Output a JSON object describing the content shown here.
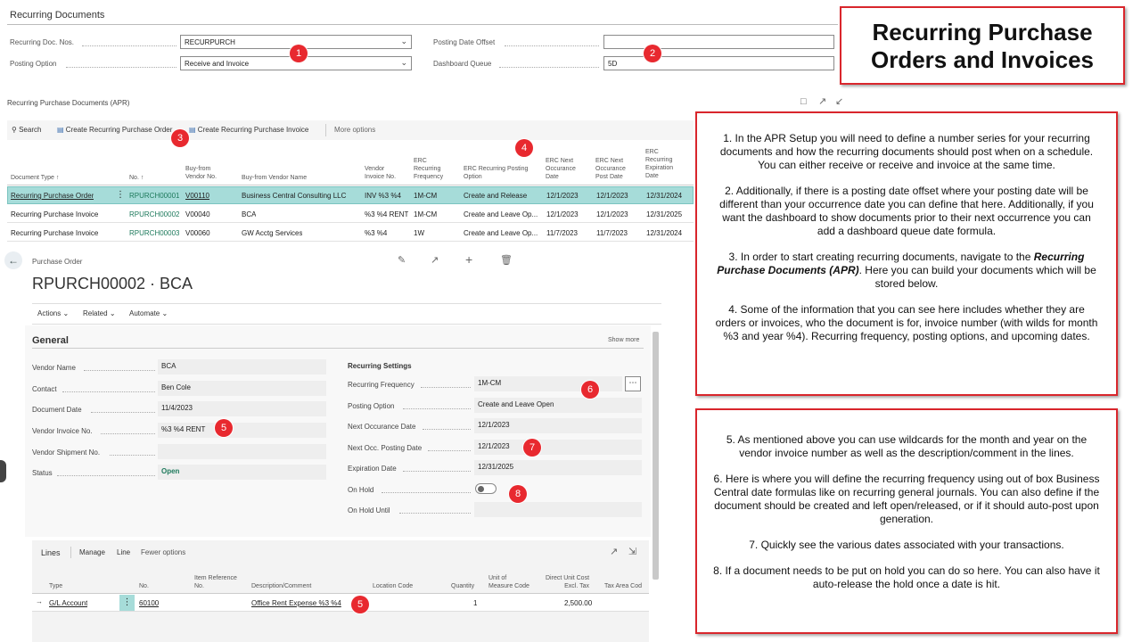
{
  "setup": {
    "title": "Recurring Documents",
    "doc_nos_label": "Recurring Doc. Nos.",
    "doc_nos_value": "RECURPURCH",
    "posting_option_label": "Posting Option",
    "posting_option_value": "Receive and Invoice",
    "posting_date_offset_label": "Posting Date Offset",
    "posting_date_offset_value": "",
    "dashboard_queue_label": "Dashboard Queue",
    "dashboard_queue_value": "5D"
  },
  "list": {
    "title": "Recurring Purchase Documents (APR)",
    "toolbar": {
      "search": "Search",
      "create_order": "Create Recurring Purchase Order",
      "create_invoice": "Create Recurring Purchase Invoice",
      "more": "More options"
    },
    "columns": {
      "doc_type": "Document Type ↑",
      "no": "No. ↑",
      "vendor_no_1": "Buy-from",
      "vendor_no_2": "Vendor No.",
      "vendor_name": "Buy-from Vendor Name",
      "invoice_no_1": "Vendor",
      "invoice_no_2": "Invoice No.",
      "freq_1": "ERC",
      "freq_2": "Recurring",
      "freq_3": "Frequency",
      "posting_1": "ERC Recurring Posting",
      "posting_2": "Option",
      "next_occ_1": "ERC Next",
      "next_occ_2": "Occurance",
      "next_occ_3": "Date",
      "next_post_1": "ERC Next",
      "next_post_2": "Occurance",
      "next_post_3": "Post Date",
      "exp_1": "ERC",
      "exp_2": "Recurring",
      "exp_3": "Expiration",
      "exp_4": "Date"
    },
    "rows": [
      {
        "type": "Recurring Purchase Order",
        "no": "RPURCH00001",
        "vendor_no": "V00110",
        "vendor_name": "Business Central Consulting LLC",
        "invoice_no": "INV %3 %4",
        "freq": "1M-CM",
        "posting": "Create and Release",
        "next_occ": "12/1/2023",
        "next_post": "12/1/2023",
        "exp": "12/31/2024"
      },
      {
        "type": "Recurring Purchase Invoice",
        "no": "RPURCH00002",
        "vendor_no": "V00040",
        "vendor_name": "BCA",
        "invoice_no": "%3 %4 RENT",
        "freq": "1M-CM",
        "posting": "Create and Leave Op...",
        "next_occ": "12/1/2023",
        "next_post": "12/1/2023",
        "exp": "12/31/2025"
      },
      {
        "type": "Recurring Purchase Invoice",
        "no": "RPURCH00003",
        "vendor_no": "V00060",
        "vendor_name": "GW Acctg Services",
        "invoice_no": "%3 %4",
        "freq": "1W",
        "posting": "Create and Leave Op...",
        "next_occ": "11/7/2023",
        "next_post": "11/7/2023",
        "exp": "12/31/2024"
      }
    ]
  },
  "card": {
    "breadcrumb": "Purchase Order",
    "title": "RPURCH00002 · BCA",
    "actions": "Actions",
    "related": "Related",
    "automate": "Automate",
    "general": "General",
    "show_more": "Show more",
    "vendor_name_label": "Vendor Name",
    "vendor_name": "BCA",
    "contact_label": "Contact",
    "contact": "Ben Cole",
    "doc_date_label": "Document Date",
    "doc_date": "11/4/2023",
    "vendor_invoice_label": "Vendor Invoice No.",
    "vendor_invoice": "%3 %4 RENT",
    "vendor_shipment_label": "Vendor Shipment No.",
    "vendor_shipment": "",
    "status_label": "Status",
    "status": "Open",
    "recurring_settings": "Recurring Settings",
    "rec_freq_label": "Recurring Frequency",
    "rec_freq": "1M-CM",
    "posting_option_label": "Posting Option",
    "posting_option": "Create and Leave Open",
    "next_occ_label": "Next Occurance Date",
    "next_occ": "12/1/2023",
    "next_post_label": "Next Occ. Posting Date",
    "next_post": "12/1/2023",
    "exp_label": "Expiration Date",
    "exp": "12/31/2025",
    "on_hold_label": "On Hold",
    "on_hold_until_label": "On Hold Until",
    "on_hold_until": ""
  },
  "lines": {
    "title": "Lines",
    "manage": "Manage",
    "line": "Line",
    "fewer": "Fewer options",
    "col_type": "Type",
    "col_no": "No.",
    "col_itemref_1": "Item Reference",
    "col_itemref_2": "No.",
    "col_desc": "Description/Comment",
    "col_loc": "Location Code",
    "col_qty": "Quantity",
    "col_uom_1": "Unit of",
    "col_uom_2": "Measure Code",
    "col_cost_1": "Direct Unit Cost",
    "col_cost_2": "Excl. Tax",
    "col_tax": "Tax Area Cod",
    "row": {
      "type": "G/L Account",
      "no": "60100",
      "desc": "Office Rent Expense %3 %4",
      "qty": "1",
      "cost": "2,500.00"
    }
  },
  "badges": [
    "1",
    "2",
    "3",
    "4",
    "5",
    "5",
    "6",
    "7",
    "8"
  ],
  "callout": {
    "title_line1": "Recurring Purchase",
    "title_line2": "Orders and Invoices"
  },
  "notes1": {
    "p1": "1. In the APR Setup you will need to define a number series for your recurring documents and how the recurring documents should post when on a schedule. You can either receive or receive and invoice at the same time.",
    "p2": "2. Additionally, if there is a posting date offset where your posting date will be different than your occurrence date you can define that here. Additionally, if you want the dashboard to show documents prior to their next occurrence you can add a dashboard queue date formula.",
    "p3a": "3. In order to start creating recurring documents, navigate to the",
    "p3b": "Recurring Purchase Documents (APR)",
    "p3c": ". Here you can build your documents which will be stored below.",
    "p4": "4. Some of the information that you can see here includes whether they are orders or invoices, who the document is for, invoice number (with wilds for month %3 and year %4). Recurring frequency, posting options, and upcoming dates."
  },
  "notes2": {
    "p5": "5. As mentioned above you can use wildcards for the month and year on the vendor invoice number as well as the description/comment in the lines.",
    "p6": "6. Here is where you will define the recurring frequency using out of box Business Central date formulas like on recurring general journals. You can also define if the document should be created and left open/released, or if it should auto-post upon generation.",
    "p7": "7. Quickly see the various dates associated with your transactions.",
    "p8": "8. If a document needs to be put on hold you can do so here. You can also have it auto-release the hold once a date is hit."
  },
  "colors": {
    "accent": "#1e7a5c",
    "badge": "#e8292f",
    "selected_row": "#a6dcd9",
    "note_border": "#d9262c"
  }
}
